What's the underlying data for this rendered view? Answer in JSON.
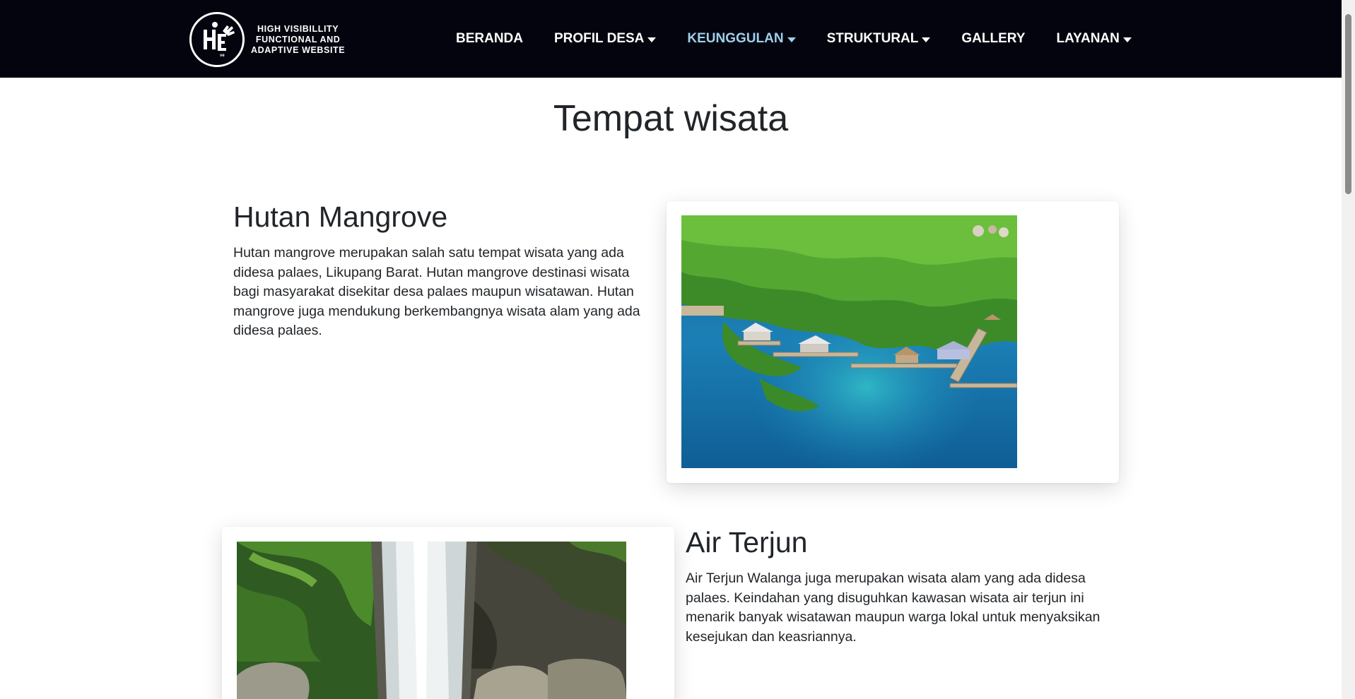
{
  "logo": {
    "icon": "hive-logo-icon",
    "line1": "HIGH VISIBILLITY",
    "line2": "FUNCTIONAL AND",
    "line3": "ADAPTIVE WEBSITE"
  },
  "nav": {
    "items": [
      {
        "label": "BERANDA"
      },
      {
        "label": "PROFIL DESA"
      },
      {
        "label": "KEUNGGULAN"
      },
      {
        "label": "STRUKTURAL"
      },
      {
        "label": "GALLERY"
      },
      {
        "label": "LAYANAN"
      }
    ],
    "active_color": "#9fd0ea",
    "background": "#04040f"
  },
  "main": {
    "title": "Tempat wisata",
    "sections": [
      {
        "heading": "Hutan Mangrove",
        "text": "Hutan mangrove merupakan salah satu tempat wisata yang ada didesa palaes, Likupang Barat. Hutan mangrove destinasi wisata bagi masyarakat disekitar desa palaes maupun wisatawan. Hutan mangrove juga mendukung berkembangnya wisata alam yang ada didesa palaes."
      },
      {
        "heading": "Air Terjun",
        "text": "Air Terjun Walanga juga merupakan wisata alam yang ada didesa palaes. Keindahan yang disuguhkan kawasan wisata air terjun ini menarik banyak wisatawan maupun warga lokal untuk menyaksikan kesejukan dan keasriannya."
      }
    ]
  }
}
